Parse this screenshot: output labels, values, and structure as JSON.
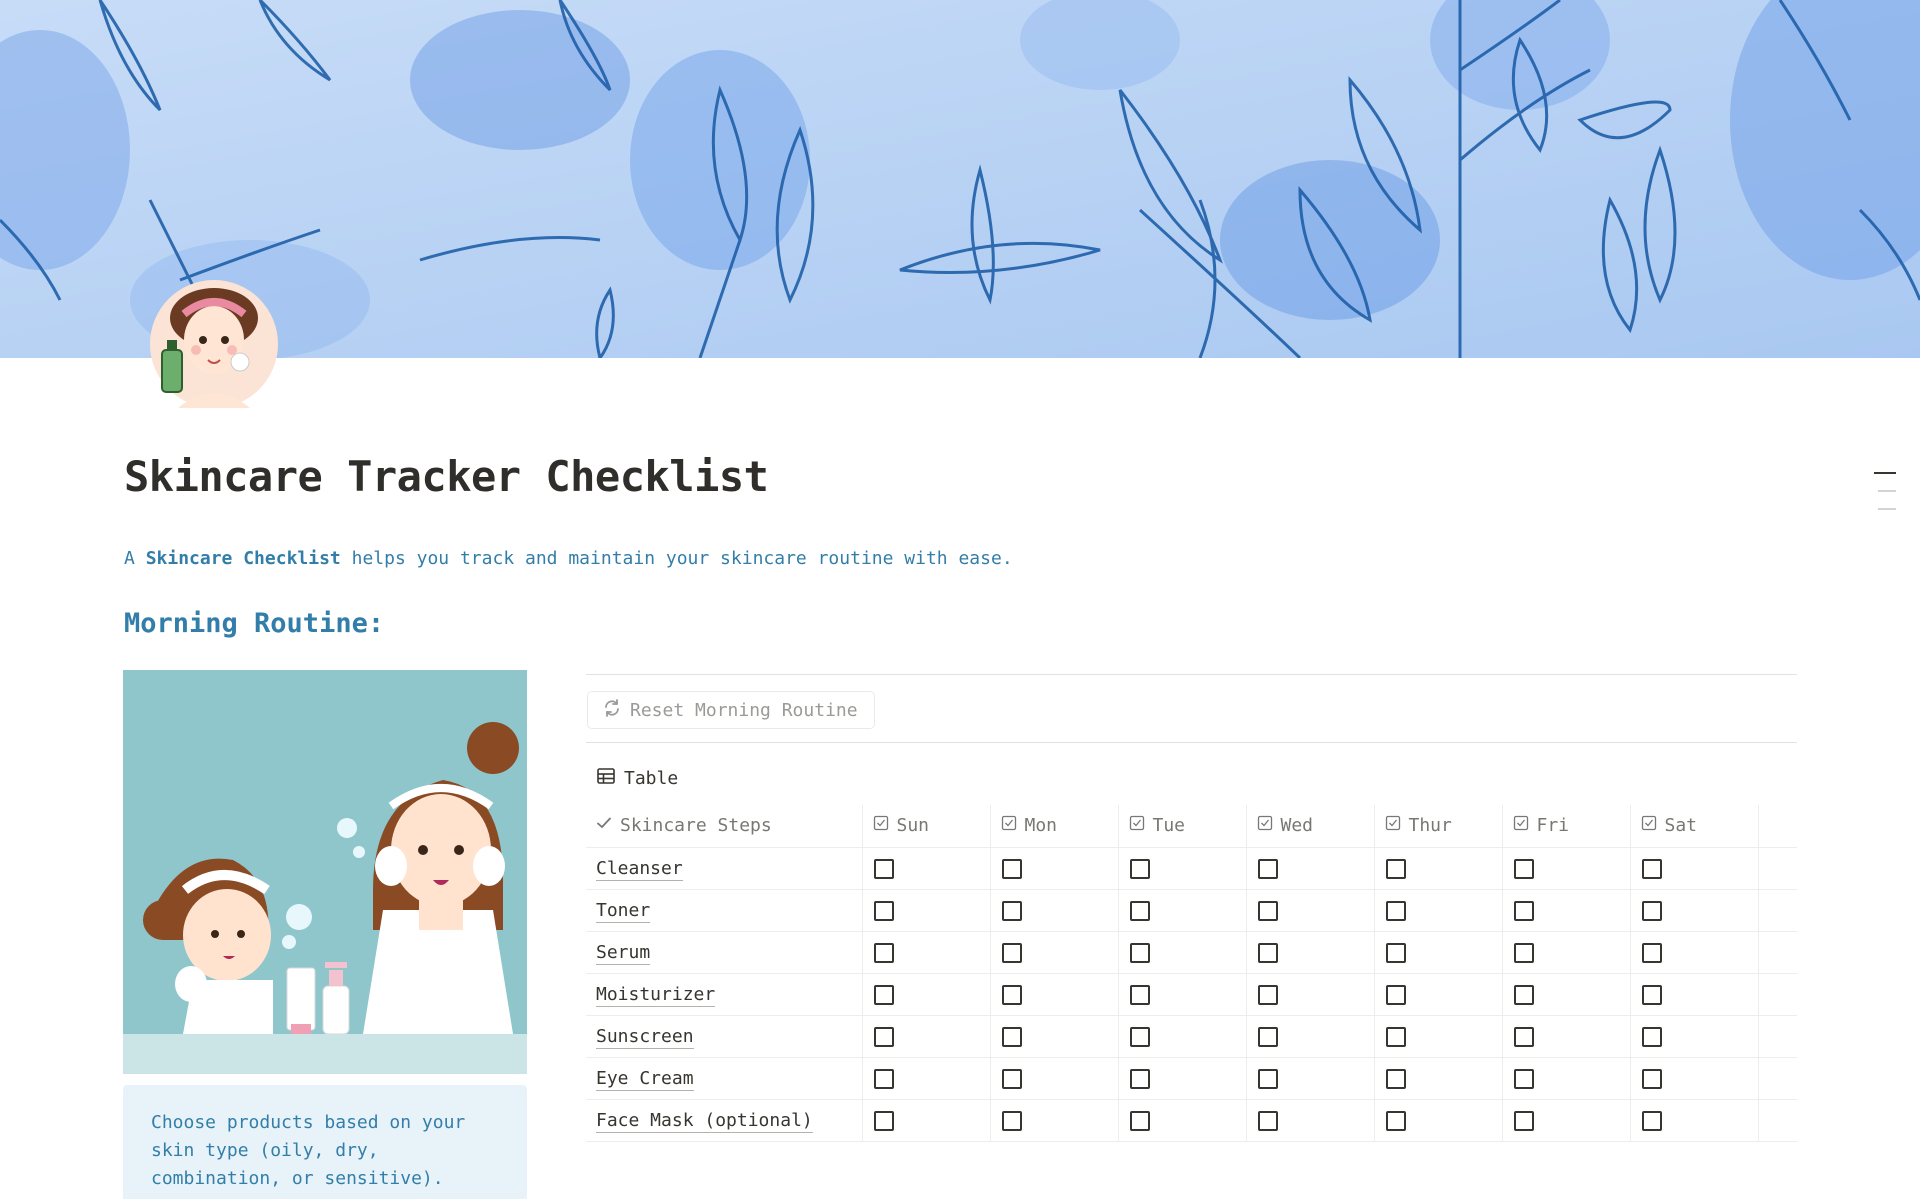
{
  "page": {
    "title": "Skincare Tracker Checklist",
    "intro_prefix": "A ",
    "intro_bold": "Skincare Checklist",
    "intro_suffix": " helps you track and maintain your skincare routine with ease."
  },
  "morning": {
    "heading": "Morning Routine:",
    "callout": "Choose products based on your skin type (oily, dry, combination, or sensitive).",
    "reset_button_label": "Reset Morning Routine",
    "view_tab_label": "Table",
    "columns": [
      "Skincare Steps",
      "Sun",
      "Mon",
      "Tue",
      "Wed",
      "Thur",
      "Fri",
      "Sat"
    ],
    "rows": [
      {
        "step": "Cleanser",
        "checked": [
          false,
          false,
          false,
          false,
          false,
          false,
          false
        ]
      },
      {
        "step": "Toner",
        "checked": [
          false,
          false,
          false,
          false,
          false,
          false,
          false
        ]
      },
      {
        "step": "Serum",
        "checked": [
          false,
          false,
          false,
          false,
          false,
          false,
          false
        ]
      },
      {
        "step": "Moisturizer",
        "checked": [
          false,
          false,
          false,
          false,
          false,
          false,
          false
        ]
      },
      {
        "step": "Sunscreen",
        "checked": [
          false,
          false,
          false,
          false,
          false,
          false,
          false
        ]
      },
      {
        "step": "Eye Cream",
        "checked": [
          false,
          false,
          false,
          false,
          false,
          false,
          false
        ]
      },
      {
        "step": "Face Mask (optional)",
        "checked": [
          false,
          false,
          false,
          false,
          false,
          false,
          false
        ]
      }
    ]
  },
  "colors": {
    "accent_blue_text": "#337ea9",
    "callout_bg": "#e7f3f8",
    "cover_bg": "#b9d3f5",
    "cover_leaf_stroke": "#1f5fa8",
    "illustration_bg": "#8fc6cc"
  },
  "icons": {
    "reset": "refresh-icon",
    "table_view": "table-icon",
    "title_column": "checkmark-icon",
    "day_columns": "checkbox-property-icon"
  }
}
